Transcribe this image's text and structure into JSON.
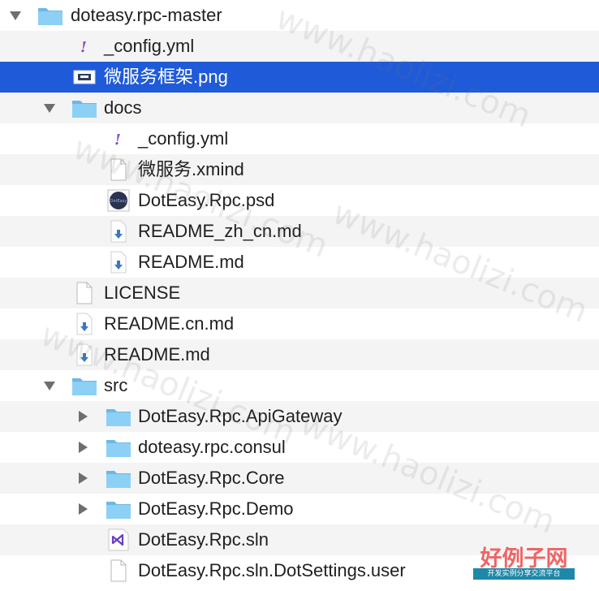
{
  "colors": {
    "selection": "#1f5ad8",
    "alt_row": "#f4f4f5",
    "folder": "#7cc7f2",
    "yaml_mark": "#8a4ec2",
    "markdown_arrow": "#3a78c3",
    "vs_purple": "#6a3fbf"
  },
  "rows": [
    {
      "label": "doteasy.rpc-master",
      "icon": "folder-icon",
      "expanded": true
    },
    {
      "label": "_config.yml",
      "icon": "yaml-file-icon"
    },
    {
      "label": "微服务框架.png",
      "icon": "png-image-icon",
      "selected": true
    },
    {
      "label": "docs",
      "icon": "folder-icon",
      "expanded": true
    },
    {
      "label": "_config.yml",
      "icon": "yaml-file-icon"
    },
    {
      "label": "微服务.xmind",
      "icon": "blank-file-icon"
    },
    {
      "label": "DotEasy.Rpc.psd",
      "icon": "psd-file-icon"
    },
    {
      "label": "README_zh_cn.md",
      "icon": "markdown-file-icon"
    },
    {
      "label": "README.md",
      "icon": "markdown-file-icon"
    },
    {
      "label": "LICENSE",
      "icon": "blank-file-icon"
    },
    {
      "label": "README.cn.md",
      "icon": "markdown-file-icon"
    },
    {
      "label": "README.md",
      "icon": "markdown-file-icon"
    },
    {
      "label": "src",
      "icon": "folder-icon",
      "expanded": true
    },
    {
      "label": "DotEasy.Rpc.ApiGateway",
      "icon": "folder-icon",
      "expanded": false
    },
    {
      "label": "doteasy.rpc.consul",
      "icon": "folder-icon",
      "expanded": false
    },
    {
      "label": "DotEasy.Rpc.Core",
      "icon": "folder-icon",
      "expanded": false
    },
    {
      "label": "DotEasy.Rpc.Demo",
      "icon": "folder-icon",
      "expanded": false
    },
    {
      "label": "DotEasy.Rpc.sln",
      "icon": "visual-studio-solution-icon"
    },
    {
      "label": "DotEasy.Rpc.sln.DotSettings.user",
      "icon": "blank-file-icon"
    }
  ],
  "watermark": {
    "text": "www.haolizi.com"
  },
  "logo": {
    "title": "好例子网",
    "subtitle": "开发实例分享交流平台"
  }
}
